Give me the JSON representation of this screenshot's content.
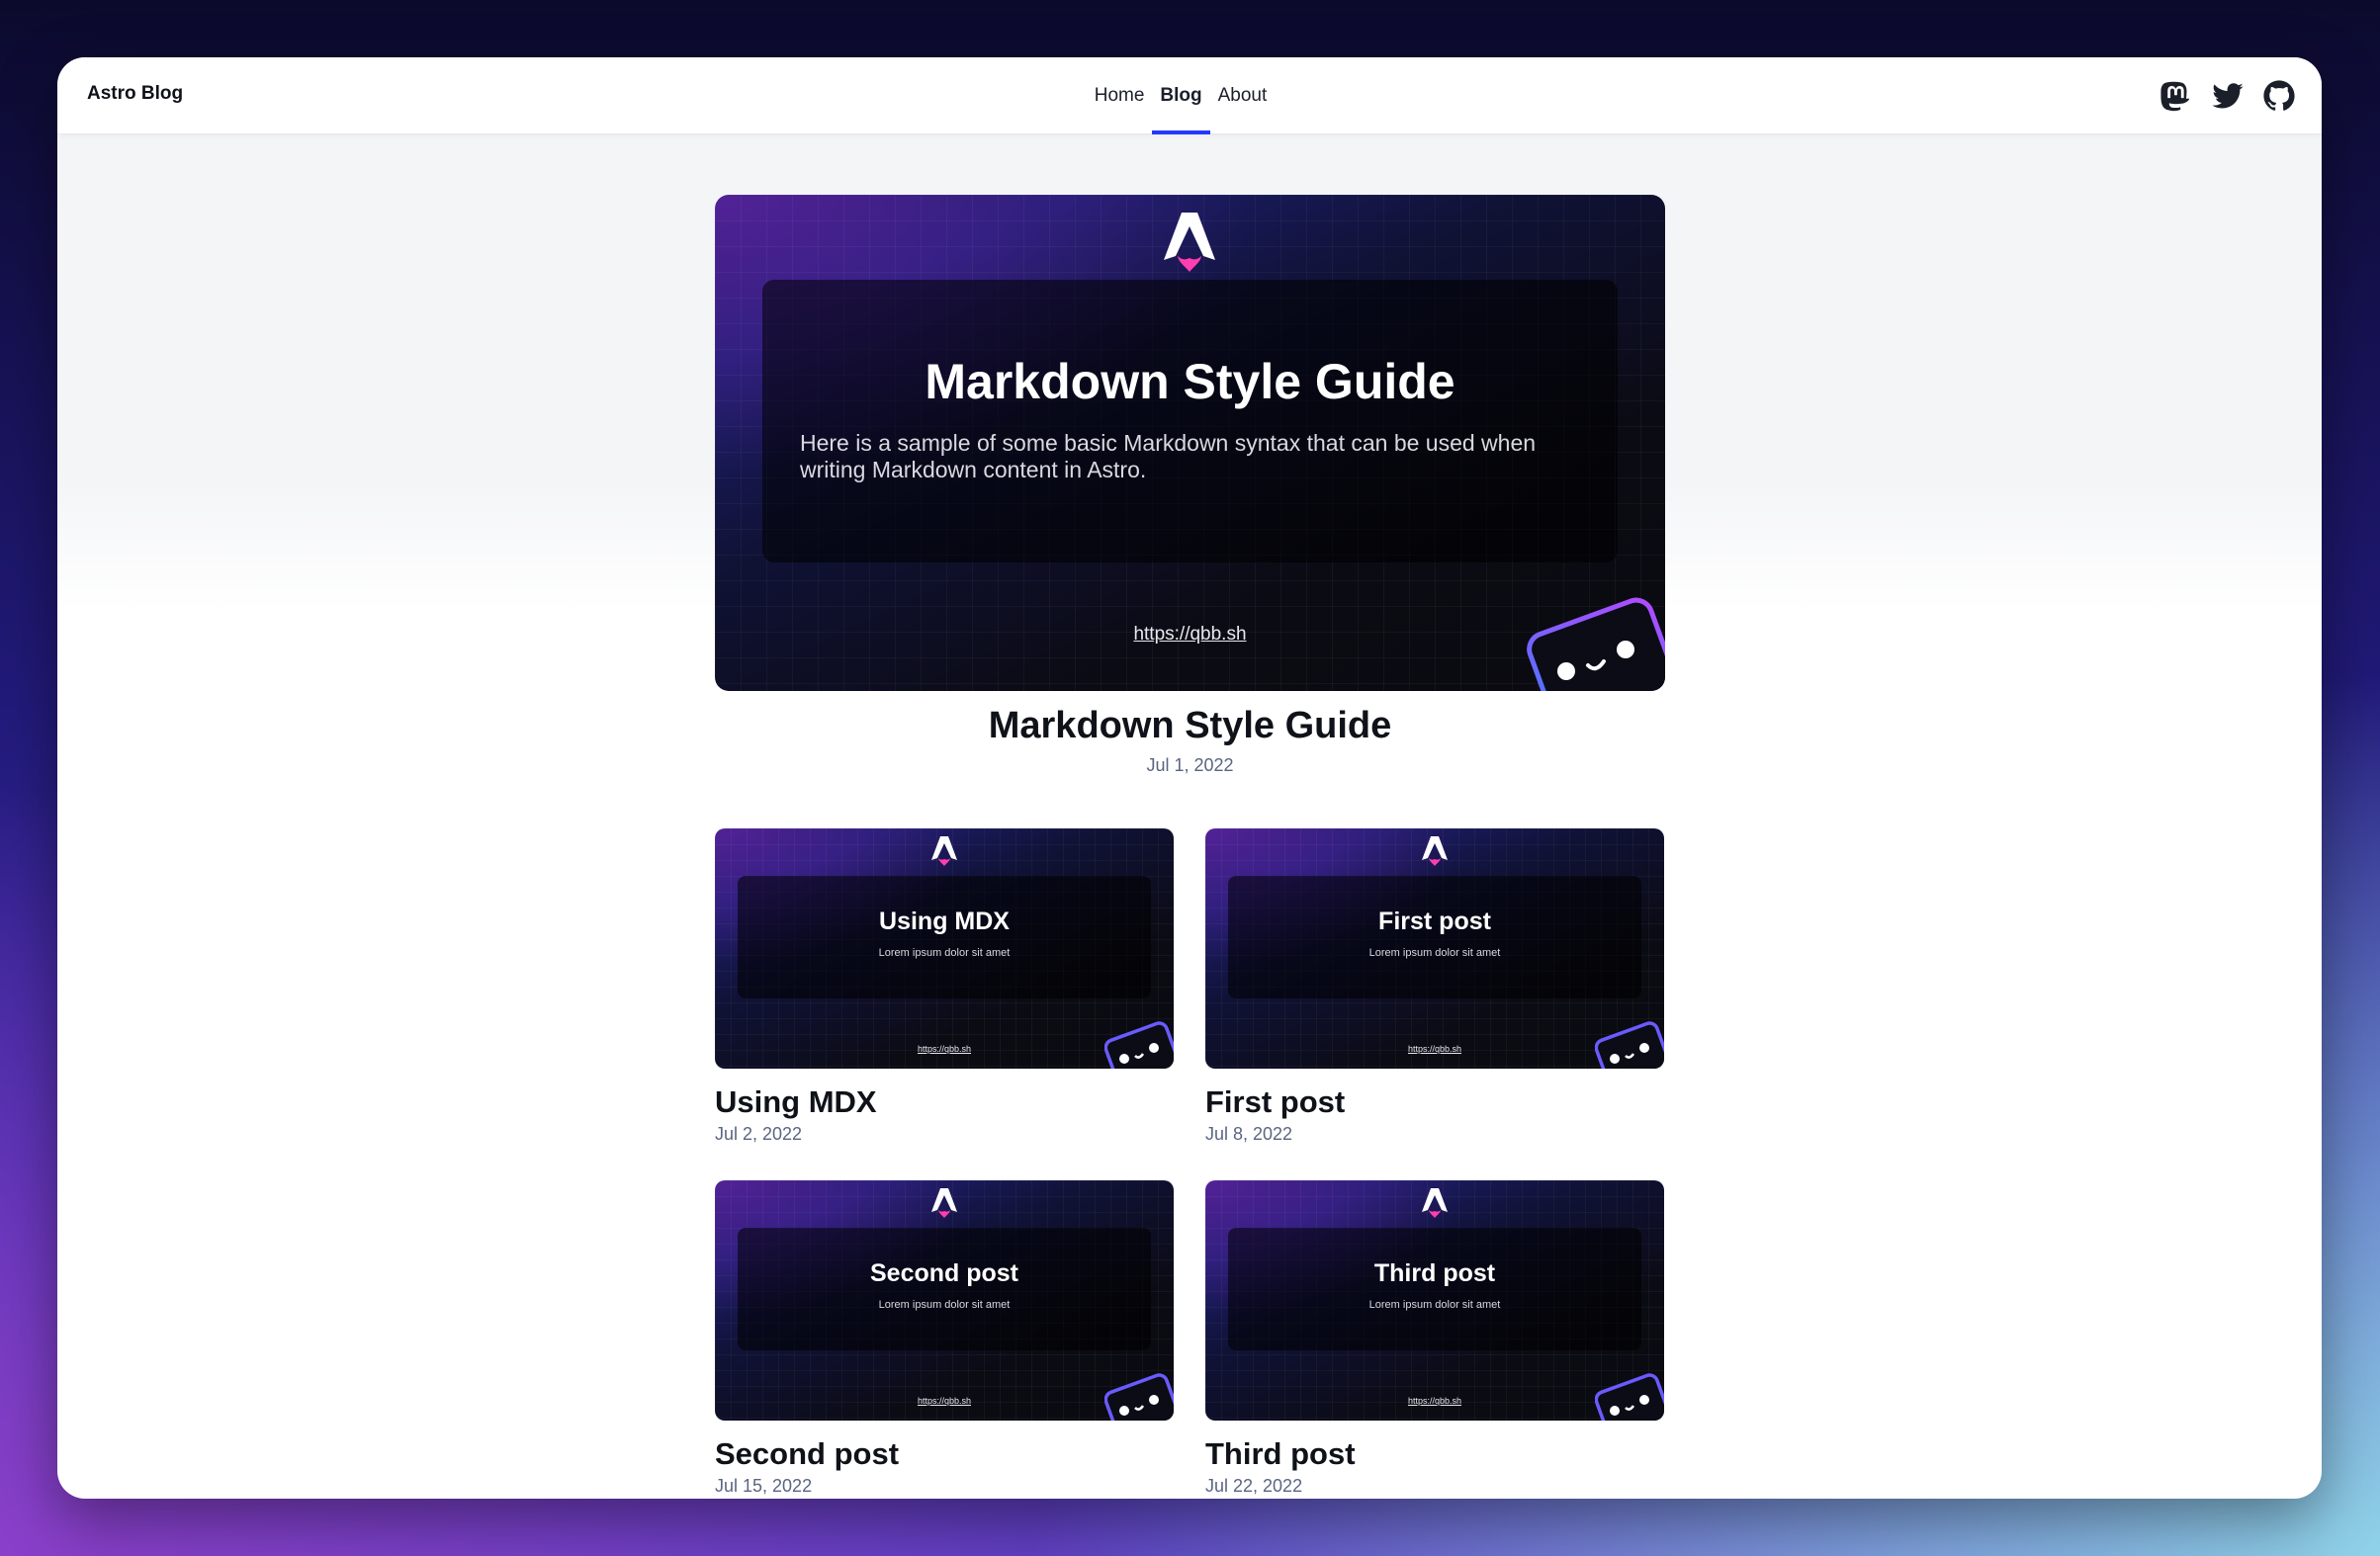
{
  "header": {
    "brand": "Astro Blog",
    "nav": [
      {
        "label": "Home"
      },
      {
        "label": "Blog"
      },
      {
        "label": "About"
      }
    ],
    "active_nav": "Blog",
    "social_icons": [
      "mastodon-icon",
      "twitter-icon",
      "github-icon"
    ]
  },
  "featured": {
    "image_title": "Markdown Style Guide",
    "image_description": "Here is a sample of some basic Markdown syntax that can be used when writing Markdown content in Astro.",
    "image_url": "https://qbb.sh",
    "title": "Markdown Style Guide",
    "date": "Jul 1, 2022"
  },
  "posts": [
    {
      "image_title": "Using MDX",
      "image_description": "Lorem ipsum dolor sit amet",
      "image_url": "https://qbb.sh",
      "title": "Using MDX",
      "date": "Jul 2, 2022"
    },
    {
      "image_title": "First post",
      "image_description": "Lorem ipsum dolor sit amet",
      "image_url": "https://qbb.sh",
      "title": "First post",
      "date": "Jul 8, 2022"
    },
    {
      "image_title": "Second post",
      "image_description": "Lorem ipsum dolor sit amet",
      "image_url": "https://qbb.sh",
      "title": "Second post",
      "date": "Jul 15, 2022"
    },
    {
      "image_title": "Third post",
      "image_description": "Lorem ipsum dolor sit amet",
      "image_url": "https://qbb.sh",
      "title": "Third post",
      "date": "Jul 22, 2022"
    }
  ],
  "colors": {
    "accent": "#2337ff",
    "text": "#0f1219",
    "date": "#5a6580"
  }
}
